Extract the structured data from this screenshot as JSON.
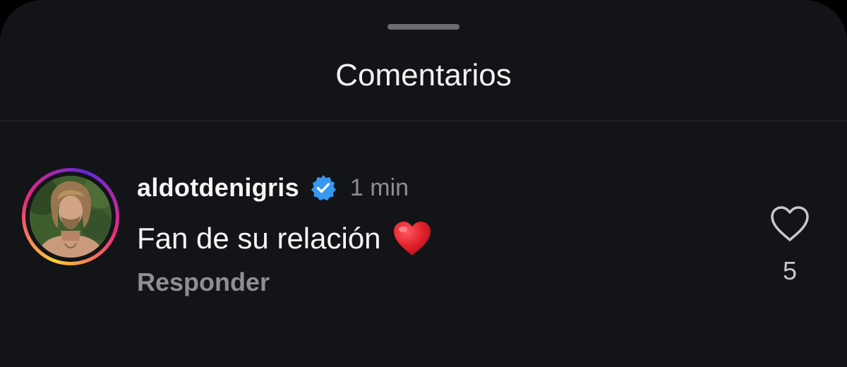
{
  "sheet": {
    "title": "Comentarios"
  },
  "comment": {
    "username": "aldotdenigris",
    "verified": true,
    "time": "1 min",
    "text": "Fan de su relación",
    "emoji": "red-heart",
    "reply_label": "Responder",
    "like_count": "5"
  },
  "colors": {
    "background": "#131418",
    "verified_badge": "#3897f0",
    "muted_text": "#8e8e93",
    "heart_emoji": "#e0202b"
  },
  "icons": {
    "grabber": "drag-handle",
    "verified": "verified-badge-icon",
    "like": "heart-outline-icon",
    "emoji": "red-heart-emoji"
  }
}
